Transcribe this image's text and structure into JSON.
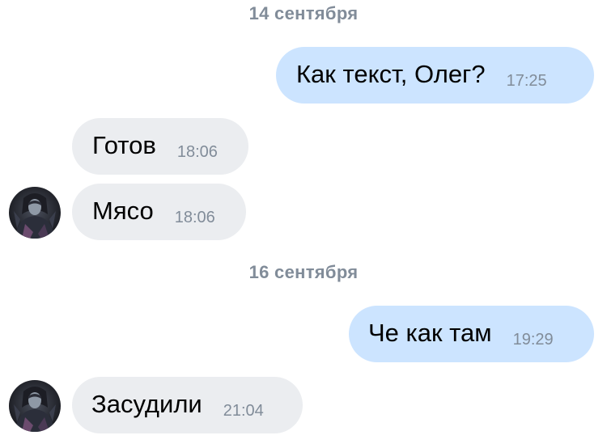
{
  "dates": [
    "14 сентября",
    "16 сентября"
  ],
  "messages": [
    {
      "direction": "outgoing",
      "text": "Как текст, Олег?",
      "time": "17:25"
    },
    {
      "direction": "incoming",
      "text": "Готов",
      "time": "18:06"
    },
    {
      "direction": "incoming",
      "text": "Мясо",
      "time": "18:06"
    },
    {
      "direction": "outgoing",
      "text": "Че как там",
      "time": "19:29"
    },
    {
      "direction": "incoming",
      "text": "Засудили",
      "time": "21:04"
    }
  ],
  "colors": {
    "outgoing_bubble": "#cce4ff",
    "incoming_bubble": "#ebedf0",
    "meta_text": "#818c99"
  },
  "avatar_icon": "user-avatar-dark-hooded-figure"
}
